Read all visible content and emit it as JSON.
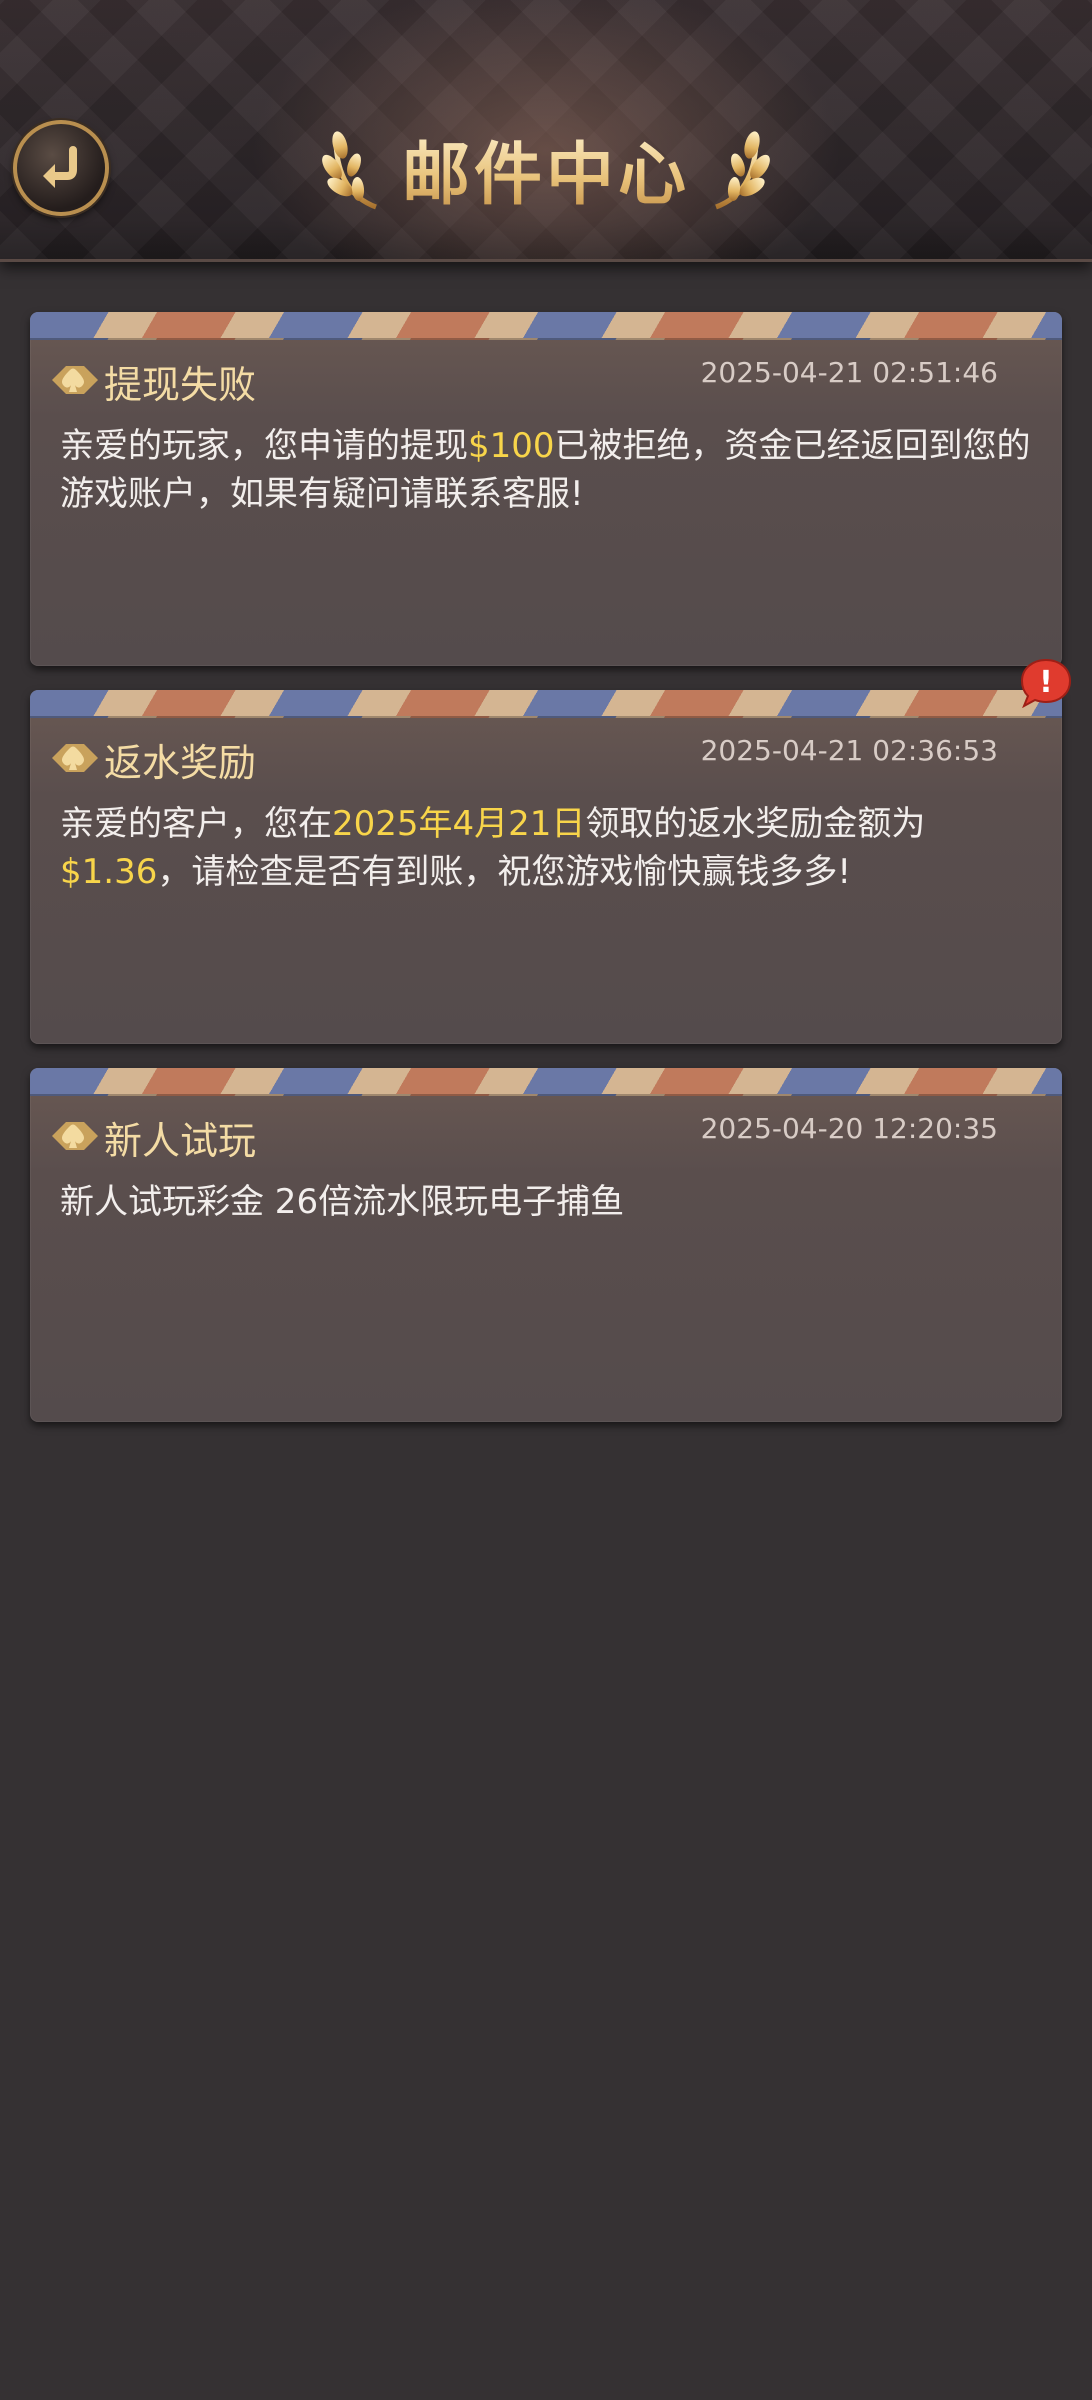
{
  "header": {
    "title": "邮件中心",
    "back_icon": "return-arrow-icon"
  },
  "colors": {
    "background": "#353133",
    "title_gold": "#e8c27a",
    "highlight": "#f8d54a",
    "badge_red": "#e03b2e"
  },
  "mails": [
    {
      "title": "提现失败",
      "time": "2025-04-21 02:51:46",
      "body_parts": [
        {
          "text": "亲爱的玩家，您申请的提现",
          "highlight": false
        },
        {
          "text": "$100",
          "highlight": true
        },
        {
          "text": "已被拒绝，资金已经返回到您的游戏账户，如果有疑问请联系客服!",
          "highlight": false
        }
      ],
      "unread": false
    },
    {
      "title": "返水奖励",
      "time": "2025-04-21 02:36:53",
      "body_parts": [
        {
          "text": "亲爱的客户，您在",
          "highlight": false
        },
        {
          "text": "2025年4月21日",
          "highlight": true
        },
        {
          "text": "领取的返水奖励金额为",
          "highlight": false
        },
        {
          "text": "$1.36",
          "highlight": true
        },
        {
          "text": "，请检查是否有到账，祝您游戏愉快赢钱多多!",
          "highlight": false
        }
      ],
      "unread": true,
      "badge": "!"
    },
    {
      "title": "新人试玩",
      "time": "2025-04-20 12:20:35",
      "body_parts": [
        {
          "text": "新人试玩彩金 26倍流水限玩电子捕鱼",
          "highlight": false
        }
      ],
      "unread": false
    }
  ]
}
